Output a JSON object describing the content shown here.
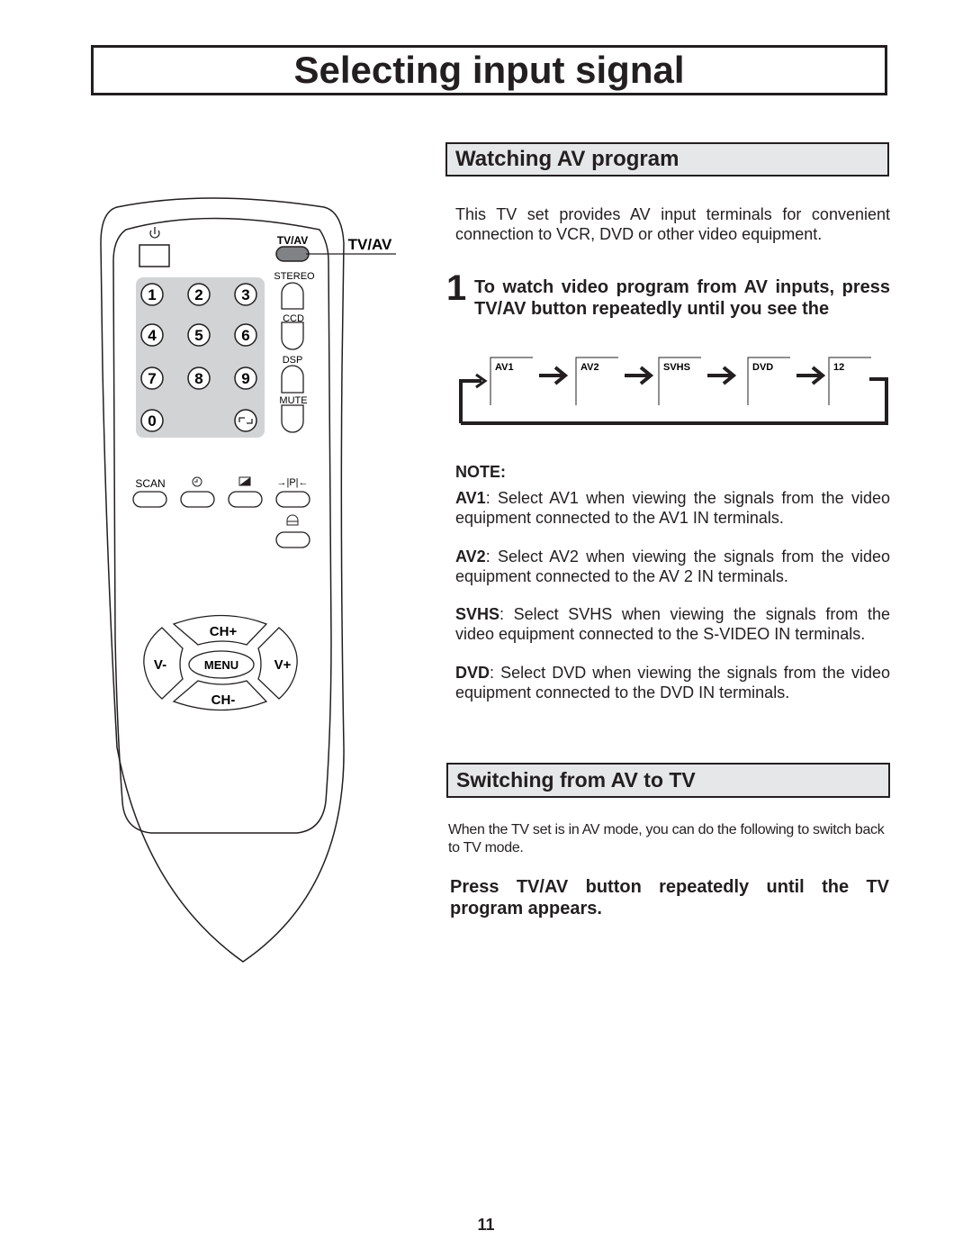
{
  "page": {
    "title": "Selecting input signal",
    "page_number": "11"
  },
  "remote": {
    "callout_label": "TV/AV",
    "buttons": {
      "power_icon": "power-icon",
      "tv_av": "TV/AV",
      "stereo": "STEREO",
      "ccd": "CCD",
      "dsp": "DSP",
      "mute": "MUTE",
      "digits": [
        "1",
        "2",
        "3",
        "4",
        "5",
        "6",
        "7",
        "8",
        "9",
        "0"
      ],
      "recall_icon": "recall-icon",
      "scan": "SCAN",
      "timer_icon": "clock-icon",
      "picture_icon": "picture-mode-icon",
      "pp_label": "→|P|←",
      "lock_icon": "lock-icon",
      "ch_plus": "CH+",
      "ch_minus": "CH-",
      "v_minus": "V-",
      "v_plus": "V+",
      "menu": "MENU"
    }
  },
  "watching": {
    "heading": "Watching AV program",
    "intro": "This TV set provides AV input terminals for convenient connection to VCR, DVD or other video equipment.",
    "step_number": "1",
    "step_text": "To watch video program from AV inputs, press TV/AV button repeatedly until you see the",
    "cycle": [
      "AV1",
      "AV2",
      "SVHS",
      "DVD",
      "12"
    ],
    "note_title": "NOTE:",
    "notes": [
      {
        "term": "AV1",
        "text": ":  Select AV1 when viewing the signals from the video equipment connected to the AV1 IN terminals."
      },
      {
        "term": "AV2",
        "text": ":  Select AV2 when viewing the signals from the video equipment connected to the AV 2 IN terminals."
      },
      {
        "term": "SVHS",
        "text": ":  Select SVHS when viewing the signals from the video equipment connected to the S-VIDEO IN terminals."
      },
      {
        "term": "DVD",
        "text": ":  Select DVD when viewing the signals from the video equipment connected to the DVD IN terminals."
      }
    ]
  },
  "switching": {
    "heading": "Switching from AV to TV",
    "intro": "When the TV set is in AV mode, you can do the following to switch back to TV mode.",
    "instruction": "Press TV/AV button repeatedly until the TV program appears."
  }
}
